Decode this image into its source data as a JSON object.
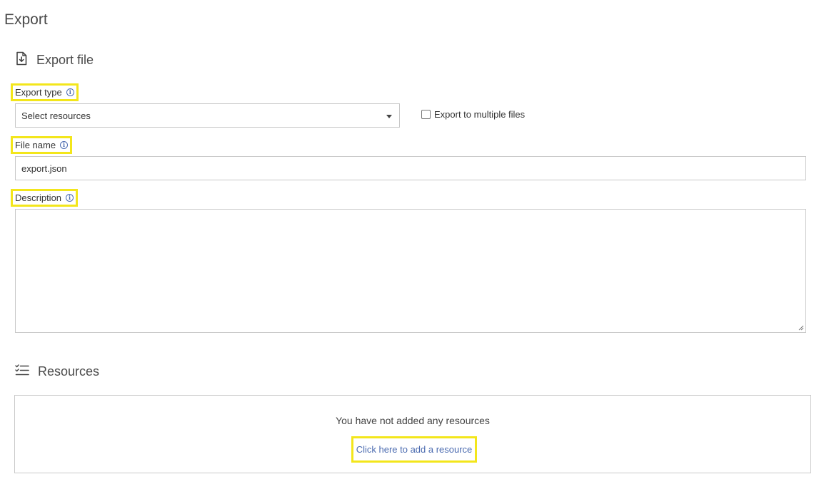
{
  "page": {
    "title": "Export"
  },
  "export_section": {
    "title": "Export file",
    "icon": "file-download-icon"
  },
  "export_type": {
    "label": "Export type",
    "selected": "Select resources",
    "multiple_files_label": "Export to multiple files",
    "multiple_files_checked": false
  },
  "file_name": {
    "label": "File name",
    "value": "export.json"
  },
  "description": {
    "label": "Description",
    "value": ""
  },
  "resources_section": {
    "title": "Resources",
    "icon": "checklist-icon",
    "empty_message": "You have not added any resources",
    "add_link": "Click here to add a resource"
  },
  "colors": {
    "highlight": "#f3e61b",
    "link": "#4b6bb0",
    "border": "#c8c8c8"
  }
}
